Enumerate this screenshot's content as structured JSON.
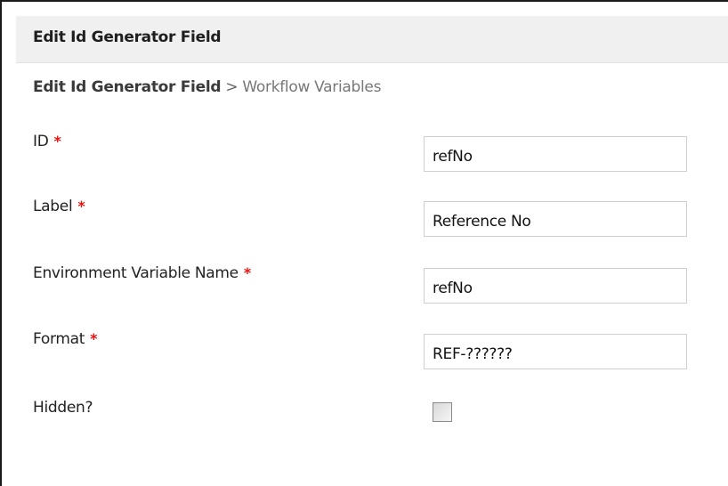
{
  "header": {
    "title": "Edit Id Generator Field"
  },
  "breadcrumb": {
    "current": "Edit Id Generator Field",
    "separator": ">",
    "next": "Workflow Variables"
  },
  "form": {
    "required_marker": "*",
    "fields": [
      {
        "label": "ID",
        "value": "refNo",
        "required": true
      },
      {
        "label": "Label",
        "value": "Reference No",
        "required": true
      },
      {
        "label": "Environment Variable Name",
        "value": "refNo",
        "required": true
      },
      {
        "label": "Format",
        "value": "REF-??????",
        "required": true
      }
    ],
    "hidden": {
      "label": "Hidden?",
      "checked": false
    }
  },
  "colors": {
    "header_bg": "#f0f0f0",
    "required": "#ee1111",
    "breadcrumb_muted": "#777777"
  }
}
